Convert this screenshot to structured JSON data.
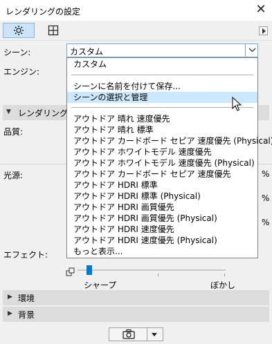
{
  "window": {
    "title": "レンダリングの設定",
    "close_glyph": "✕"
  },
  "toolbar": {
    "icons": [
      "gear-icon",
      "view-layout-icon"
    ],
    "scroll_arrow": "right-arrow"
  },
  "scene": {
    "label": "シーン:",
    "value": "カスタム"
  },
  "engine": {
    "label": "エンジン:"
  },
  "rendering_section": {
    "label": "レンダリング設定"
  },
  "quality": {
    "label": "品質:"
  },
  "light": {
    "label": "光源:",
    "pct_symbol": "%"
  },
  "effect": {
    "label": "エフェクト:"
  },
  "slider": {
    "left_label": "シャープ",
    "right_label": "ぼかし"
  },
  "sections": {
    "environment": "環境",
    "background": "背景"
  },
  "dropdown": {
    "items": [
      {
        "label": "カスタム",
        "selected": false
      },
      {
        "label": "シーンに名前を付けて保存...",
        "selected": false
      },
      {
        "label": "シーンの選択と管理",
        "selected": true
      },
      {
        "label": "アウトドア 晴れ 速度優先",
        "selected": false
      },
      {
        "label": "アウトドア 晴れ 標準",
        "selected": false
      },
      {
        "label": "アウトドア カードボード セピア 速度優先 (Physical)",
        "selected": false
      },
      {
        "label": "アウトドア ホワイトモデル 速度優先",
        "selected": false
      },
      {
        "label": "アウトドア ホワイトモデル 速度優先 (Physical)",
        "selected": false
      },
      {
        "label": "アウトドア カードボード セピア 速度優先",
        "selected": false
      },
      {
        "label": "アウトドア HDRI 標準",
        "selected": false
      },
      {
        "label": "アウトドア HDRI 標準 (Physical)",
        "selected": false
      },
      {
        "label": "アウトドア HDRI 画質優先",
        "selected": false
      },
      {
        "label": "アウトドア HDRI 画質優先 (Physical)",
        "selected": false
      },
      {
        "label": "アウトドア HDRI 速度優先",
        "selected": false
      },
      {
        "label": "アウトドア HDRI 速度優先 (Physical)",
        "selected": false
      },
      {
        "label": "もっと表示...",
        "selected": false
      }
    ]
  },
  "colors": {
    "selection": "#cce8ff",
    "accent": "#0078d7"
  }
}
